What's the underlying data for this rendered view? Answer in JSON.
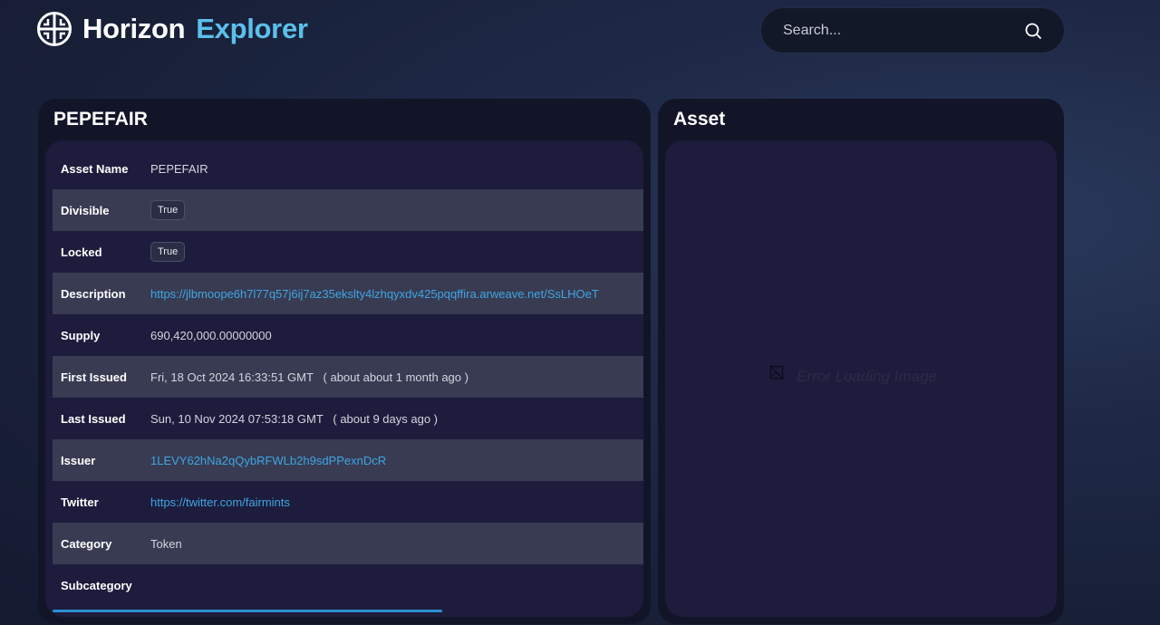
{
  "header": {
    "logo_word1": "Horizon",
    "logo_word2": "Explorer",
    "search_placeholder": "Search..."
  },
  "asset_panel": {
    "title": "PEPEFAIR",
    "rows": [
      {
        "label": "Asset Name",
        "value": "PEPEFAIR"
      },
      {
        "label": "Divisible",
        "value": "True"
      },
      {
        "label": "Locked",
        "value": "True"
      },
      {
        "label": "Description",
        "value": "https://jlbmoope6h7l77q57j6ij7az35ekslty4lzhqyxdv425pqqffira.arweave.net/SsLHOeT"
      },
      {
        "label": "Supply",
        "value": "690,420,000.00000000"
      },
      {
        "label": "First Issued",
        "value": "Fri, 18 Oct 2024 16:33:51 GMT   ( about about 1 month ago )"
      },
      {
        "label": "Last Issued",
        "value": "Sun, 10 Nov 2024 07:53:18 GMT   ( about 9 days ago )"
      },
      {
        "label": "Issuer",
        "value": "1LEVY62hNa2qQybRFWLb2h9sdPPexnDcR"
      },
      {
        "label": "Twitter",
        "value": "https://twitter.com/fairmints"
      },
      {
        "label": "Category",
        "value": "Token"
      },
      {
        "label": "Subcategory",
        "value": ""
      }
    ]
  },
  "image_panel": {
    "title": "Asset",
    "error_text": "Error Loading Image"
  },
  "colors": {
    "accent": "#5bc0eb",
    "link": "#3ea6e3"
  }
}
